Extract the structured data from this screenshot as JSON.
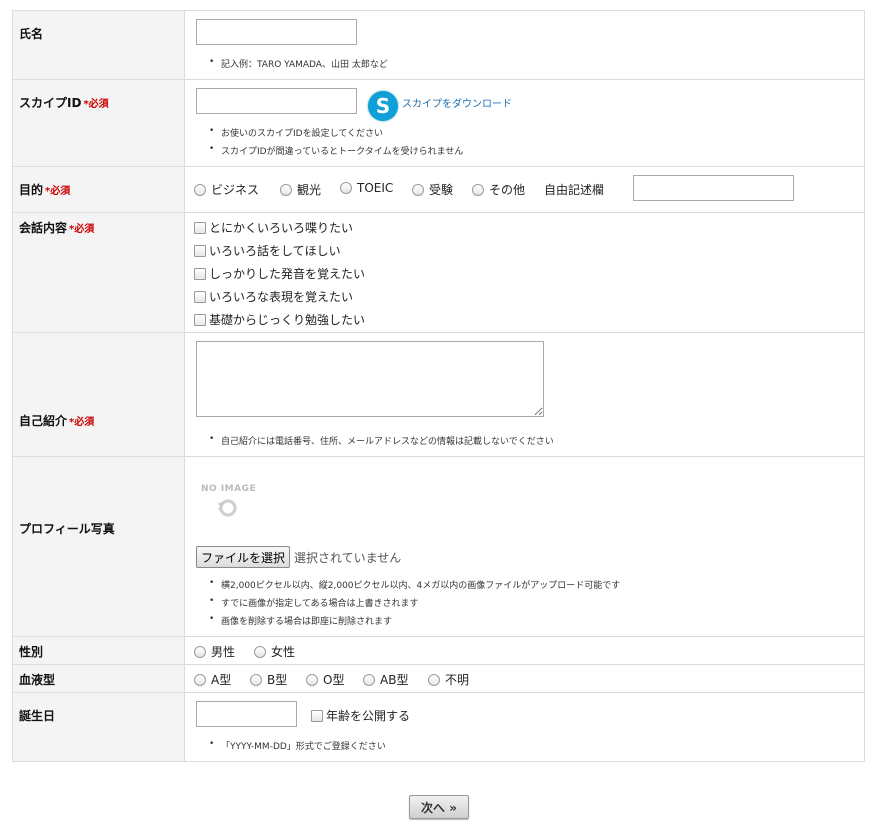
{
  "form": {
    "required_mark": "*必須",
    "name": {
      "label": "氏名",
      "note": "記入例：TARO YAMADA、山田 太郎など"
    },
    "skype": {
      "label": "スカイプID",
      "download_link": "スカイプをダウンロード",
      "notes": [
        "お使いのスカイプIDを設定してください",
        "スカイプIDが間違っているとトークタイムを受けられません"
      ]
    },
    "purpose": {
      "label": "目的",
      "options": [
        "ビジネス",
        "観光",
        "TOEIC",
        "受験",
        "その他"
      ],
      "free_label": "自由記述欄"
    },
    "conversation": {
      "label": "会話内容",
      "options": [
        "とにかくいろいろ喋りたい",
        "いろいろ話をしてほしい",
        "しっかりした発音を覚えたい",
        "いろいろな表現を覚えたい",
        "基礎からじっくり勉強したい"
      ]
    },
    "intro": {
      "label": "自己紹介",
      "note": "自己紹介には電話番号、住所、メールアドレスなどの情報は記載しないでください"
    },
    "photo": {
      "label": "プロフィール写真",
      "no_image": "NO IMAGE",
      "file_button": "ファイルを選択",
      "file_status": "選択されていません",
      "notes": [
        "横2,000ピクセル以内、縦2,000ピクセル以内、4メガ以内の画像ファイルがアップロード可能です",
        "すでに画像が指定してある場合は上書きされます",
        "画像を削除する場合は即座に削除されます"
      ]
    },
    "gender": {
      "label": "性別",
      "options": [
        "男性",
        "女性"
      ]
    },
    "blood": {
      "label": "血液型",
      "options": [
        "A型",
        "B型",
        "O型",
        "AB型",
        "不明"
      ]
    },
    "birthday": {
      "label": "誕生日",
      "public_label": "年齢を公開する",
      "note": "「YYYY-MM-DD」形式でご登録ください"
    },
    "next_button": "次へ »"
  },
  "colors": {
    "required": "#cc0000",
    "link": "#1a6fb4",
    "label_bg": "#f4f4f4",
    "border": "#dcdcdc",
    "skype": "#10a0d8"
  }
}
